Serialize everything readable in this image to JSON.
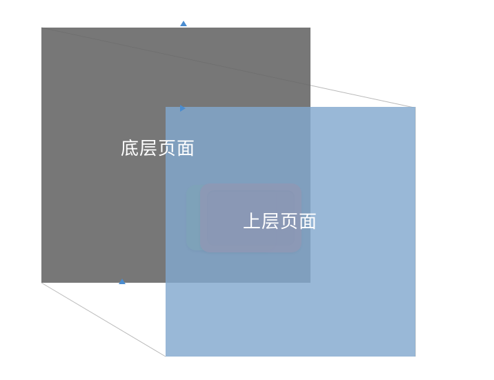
{
  "diagram": {
    "labels": {
      "bottom_layer": "底层页面",
      "top_layer": "上层页面"
    },
    "shapes": {
      "gray_box": {
        "role": "bottom-layer-page",
        "color": "#6f6f6f",
        "opacity": 0.88
      },
      "blue_box": {
        "role": "top-layer-page",
        "color": "#82a8ce",
        "opacity": 0.82
      },
      "green_rect": {
        "role": "component-behind",
        "color": "#6a8a56"
      },
      "red_rect": {
        "role": "component-front",
        "color": "#bc4f44"
      }
    },
    "markers": {
      "triangle_color": "#4a8cd0"
    }
  }
}
